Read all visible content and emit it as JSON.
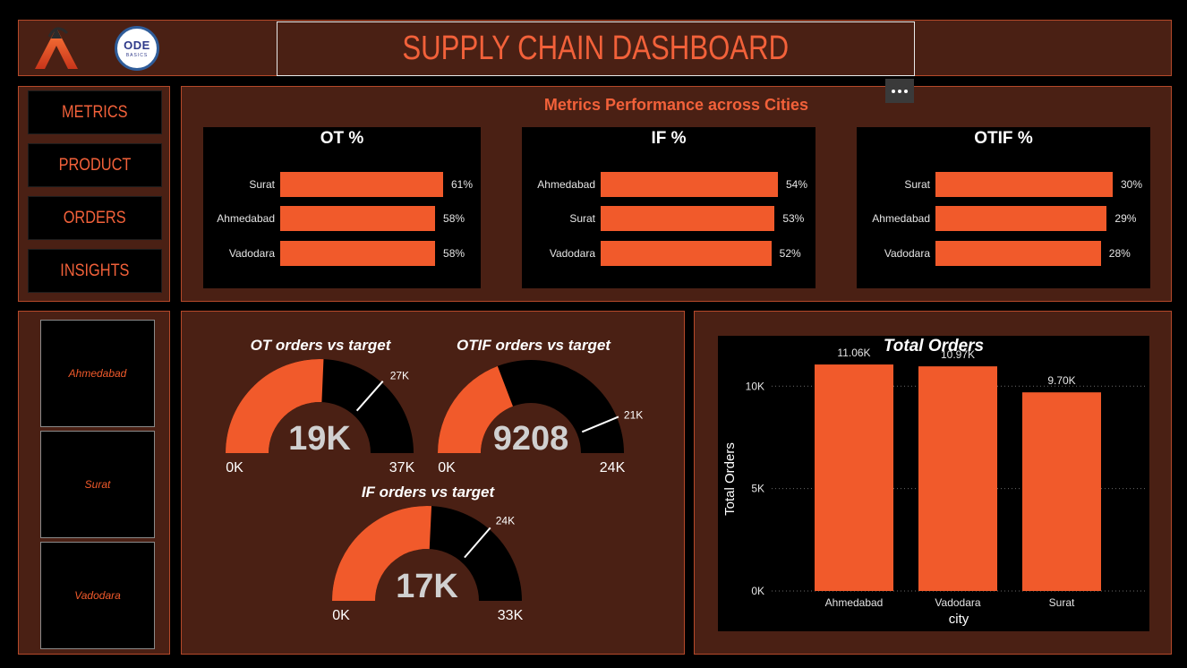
{
  "header": {
    "title": "SUPPLY CHAIN DASHBOARD",
    "logo_text_1": "ODE",
    "logo_text_2": "BASICS"
  },
  "nav": {
    "items": [
      {
        "label": "METRICS"
      },
      {
        "label": "PRODUCT"
      },
      {
        "label": "ORDERS"
      },
      {
        "label": "INSIGHTS"
      }
    ]
  },
  "cities": {
    "items": [
      {
        "label": "Ahmedabad"
      },
      {
        "label": "Surat"
      },
      {
        "label": "Vadodara"
      }
    ]
  },
  "colors": {
    "accent": "#f15a2b",
    "panel": "#4a2014",
    "panel_border": "#b5492a",
    "gauge_remaining": "#000000"
  },
  "chart_data": [
    {
      "type": "bar",
      "orientation": "horizontal",
      "section_title": "Metrics Performance across Cities",
      "title": "OT %",
      "categories": [
        "Surat",
        "Ahmedabad",
        "Vadodara"
      ],
      "values": [
        61,
        58,
        58
      ],
      "value_labels": [
        "61%",
        "58%",
        "58%"
      ],
      "xlim": [
        0,
        61
      ]
    },
    {
      "type": "bar",
      "orientation": "horizontal",
      "title": "IF %",
      "categories": [
        "Ahmedabad",
        "Surat",
        "Vadodara"
      ],
      "values": [
        54,
        53,
        52
      ],
      "value_labels": [
        "54%",
        "53%",
        "52%"
      ],
      "xlim": [
        0,
        54
      ]
    },
    {
      "type": "bar",
      "orientation": "horizontal",
      "title": "OTIF %",
      "categories": [
        "Surat",
        "Ahmedabad",
        "Vadodara"
      ],
      "values": [
        30,
        29,
        28
      ],
      "value_labels": [
        "30%",
        "29%",
        "28%"
      ],
      "xlim": [
        0,
        30
      ]
    },
    {
      "type": "gauge",
      "title": "OT orders vs target",
      "value": 19000,
      "value_label": "19K",
      "min": 0,
      "min_label": "0K",
      "max": 37000,
      "max_label": "37K",
      "target": 27000,
      "target_label": "27K"
    },
    {
      "type": "gauge",
      "title": "OTIF orders vs target",
      "value": 9208,
      "value_label": "9208",
      "min": 0,
      "min_label": "0K",
      "max": 24000,
      "max_label": "24K",
      "target": 21000,
      "target_label": "21K"
    },
    {
      "type": "gauge",
      "title": "IF orders vs target",
      "value": 17000,
      "value_label": "17K",
      "min": 0,
      "min_label": "0K",
      "max": 33000,
      "max_label": "33K",
      "target": 24000,
      "target_label": "24K"
    },
    {
      "type": "bar",
      "title": "Total Orders",
      "xlabel": "city",
      "ylabel": "Total Orders",
      "categories": [
        "Ahmedabad",
        "Vadodara",
        "Surat"
      ],
      "values": [
        11060,
        10970,
        9700
      ],
      "value_labels": [
        "11.06K",
        "10.97K",
        "9.70K"
      ],
      "ylim": [
        0,
        11500
      ],
      "yticks": [
        0,
        5000,
        10000
      ],
      "ytick_labels": [
        "0K",
        "5K",
        "10K"
      ],
      "grid": true
    }
  ]
}
